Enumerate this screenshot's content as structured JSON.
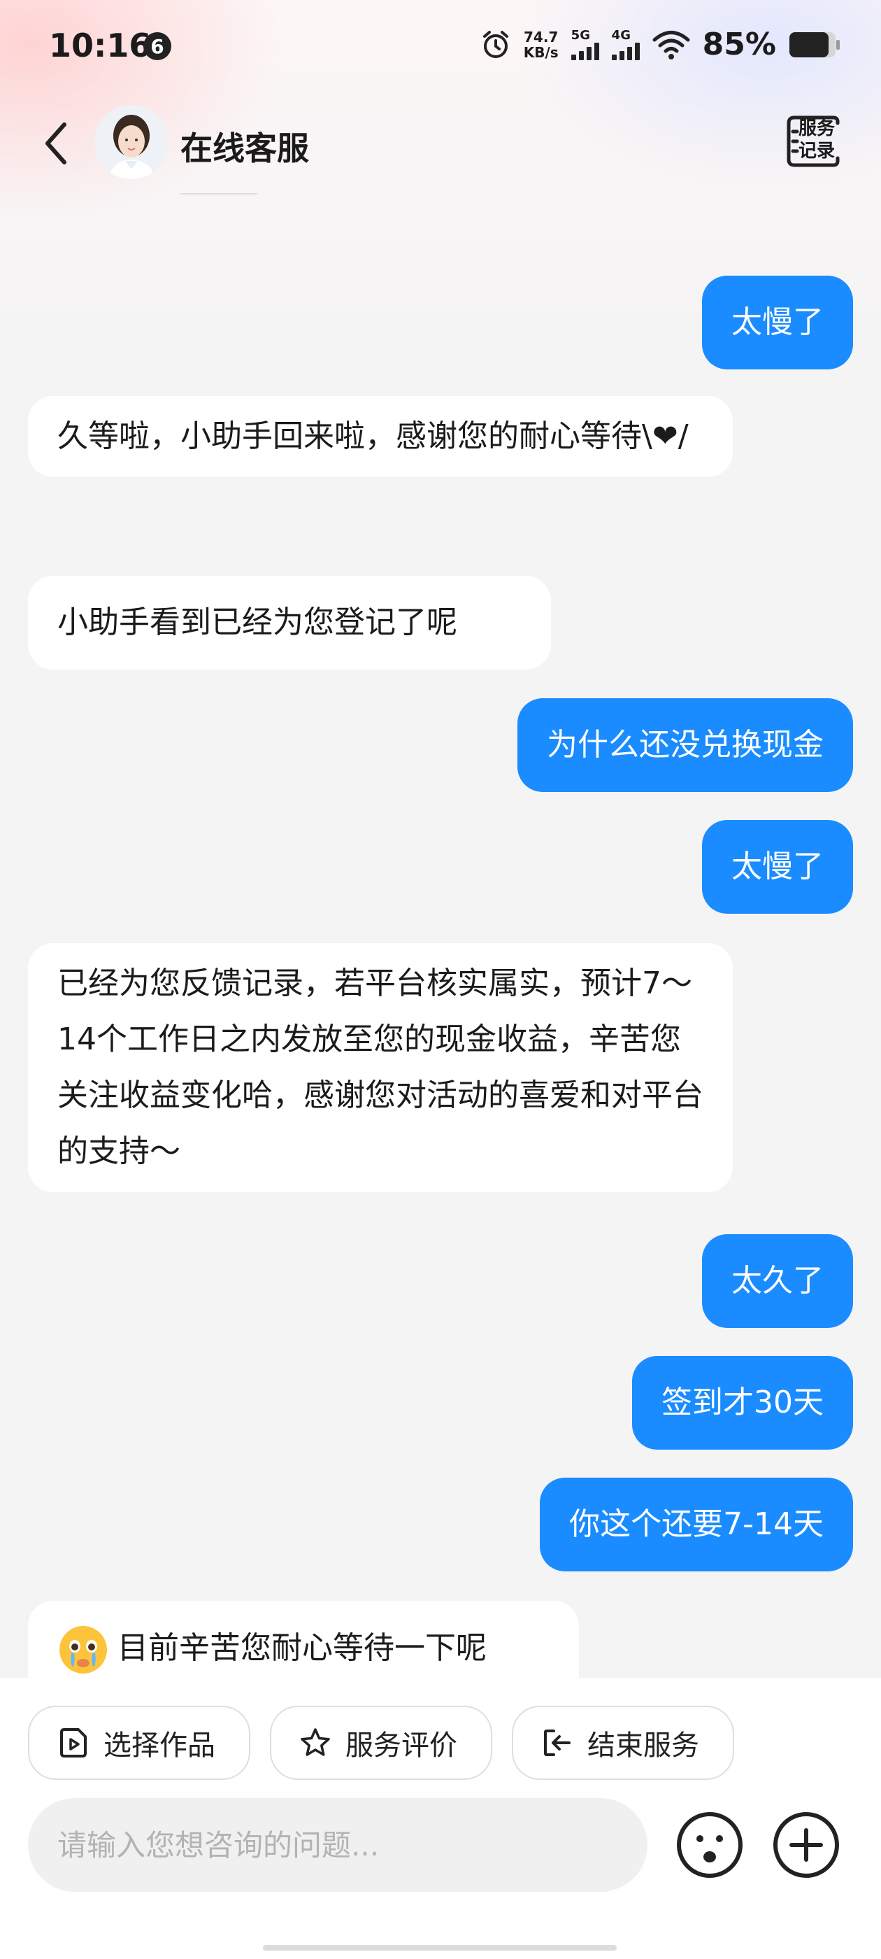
{
  "status_bar": {
    "time": "10:16",
    "notification_count": "6",
    "net_speed_value": "74.7",
    "net_speed_unit": "KB/s",
    "signal_1_label": "5G",
    "signal_2_label": "4G",
    "battery_percent": "85%"
  },
  "header": {
    "title": "在线客服",
    "service_record_label": "服务记录"
  },
  "messages": [
    {
      "side": "out",
      "text": "太慢了"
    },
    {
      "side": "in",
      "text": "久等啦，小助手回来啦，感谢您的耐心等待\\❤/"
    },
    {
      "side": "in",
      "text": "小助手看到已经为您登记了呢"
    },
    {
      "side": "out",
      "text": "为什么还没兑换现金"
    },
    {
      "side": "out",
      "text": "太慢了"
    },
    {
      "side": "in",
      "text": "已经为您反馈记录，若平台核实属实，预计7～14个工作日之内发放至您的现金收益，辛苦您关注收益变化哈，感谢您对活动的喜爱和对平台的支持～"
    },
    {
      "side": "out",
      "text": "太久了"
    },
    {
      "side": "out",
      "text": "签到才30天"
    },
    {
      "side": "out",
      "text": "你这个还要7-14天"
    },
    {
      "side": "in",
      "text": "目前辛苦您耐心等待一下呢"
    }
  ],
  "quick_actions": {
    "select_work": "选择作品",
    "rate_service": "服务评价",
    "end_service": "结束服务"
  },
  "input": {
    "placeholder": "请输入您想咨询的问题...",
    "value": ""
  },
  "colors": {
    "accent": "#1a8cff",
    "page_bg": "#f4f4f5",
    "incoming_bubble": "#ffffff"
  }
}
